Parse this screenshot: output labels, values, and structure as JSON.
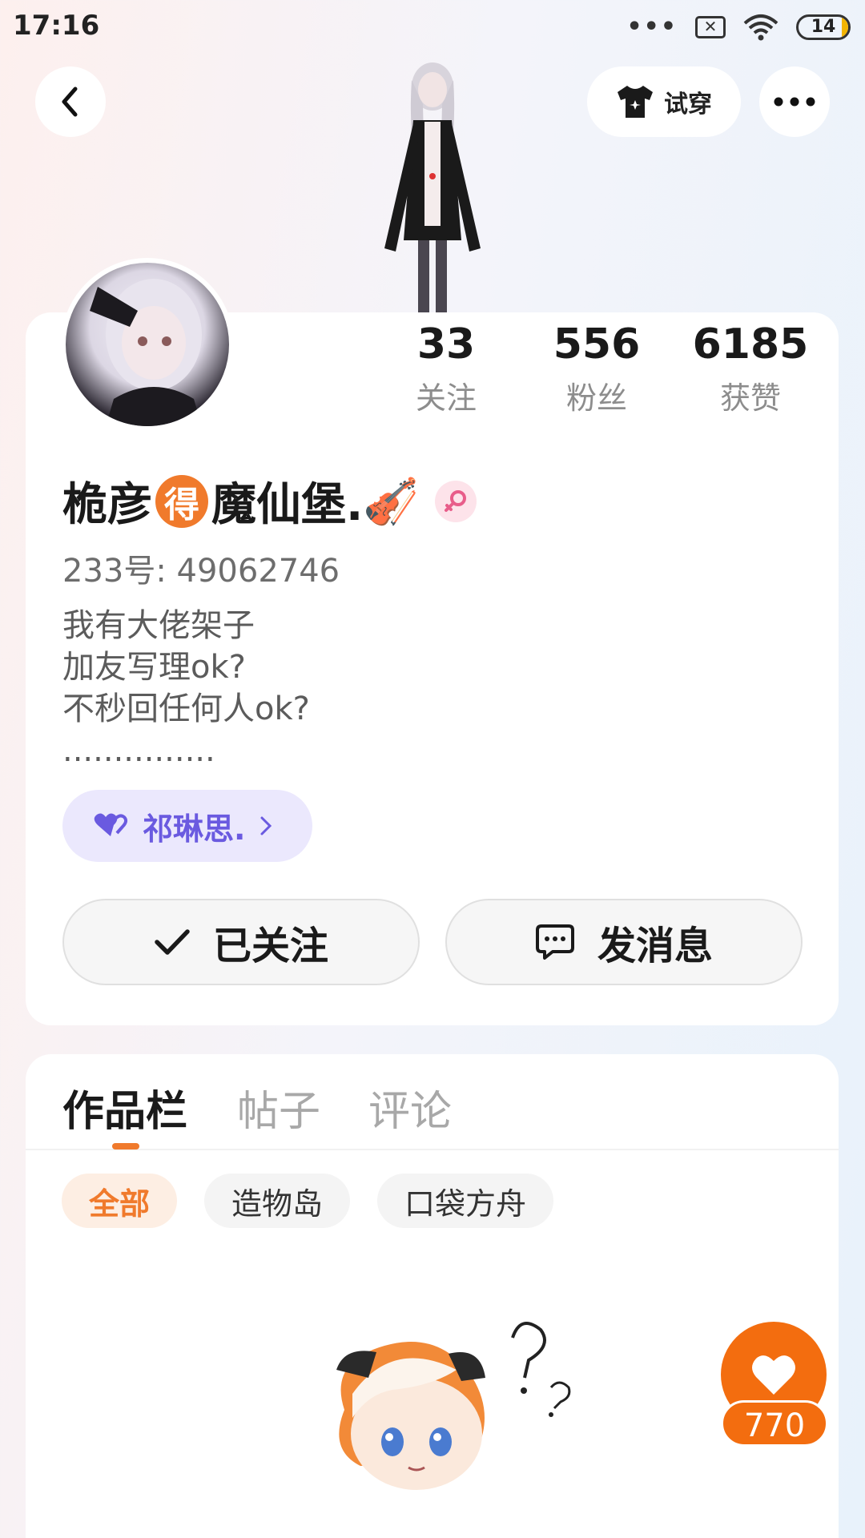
{
  "status_bar": {
    "time": "17:16",
    "dots": "•••",
    "battery": "14",
    "sim_icon": "sim-off-icon",
    "wifi_icon": "wifi-icon"
  },
  "header": {
    "back_icon": "chevron-left-icon",
    "try_on_label": "试穿",
    "try_on_icon": "shirt-icon",
    "more_icon": "more-icon"
  },
  "profile": {
    "stats": [
      {
        "value": "33",
        "label": "关注"
      },
      {
        "value": "556",
        "label": "粉丝"
      },
      {
        "value": "6185",
        "label": "获赞"
      }
    ],
    "name_part1": "桅彦",
    "name_badge": "得",
    "name_part2": "魔仙堡.",
    "name_emoji": "🎻",
    "gender_icon": "female-icon",
    "user_id": "233号: 49062746",
    "bio_lines": [
      "我有大佬架子",
      "加友写理ok?",
      "不秒回任何人ok?",
      "..............."
    ],
    "partner_label": "祁琳思.",
    "partner_icon": "hearts-icon",
    "followed_label": "已关注",
    "message_label": "发消息"
  },
  "works": {
    "tabs": [
      {
        "label": "作品栏",
        "active": true
      },
      {
        "label": "帖子",
        "active": false
      },
      {
        "label": "评论",
        "active": false
      }
    ],
    "filters": [
      {
        "label": "全部",
        "active": true
      },
      {
        "label": "造物岛",
        "active": false
      },
      {
        "label": "口袋方舟",
        "active": false
      }
    ],
    "like_count": "770"
  },
  "colors": {
    "accent": "#f07a2c",
    "partner": "#6a5ae0",
    "female": "#e85d8a"
  }
}
